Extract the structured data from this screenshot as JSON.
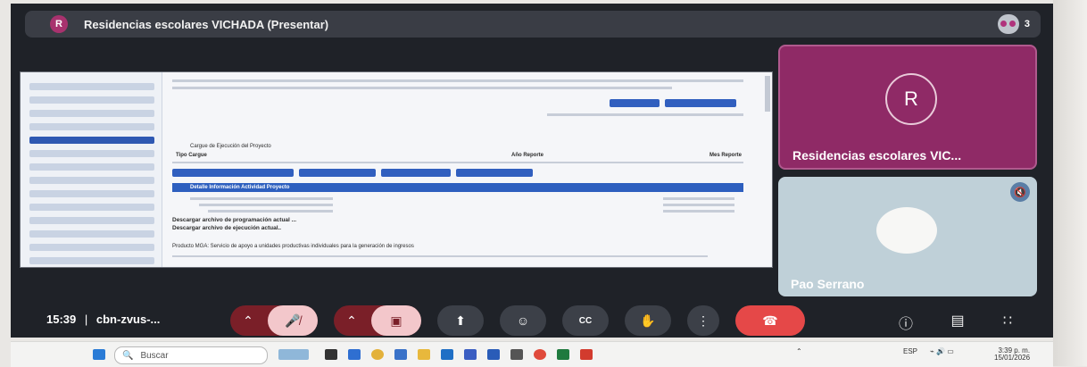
{
  "meeting": {
    "avatar_letter": "R",
    "title": "Residencias escolares VICHADA (Presentar)",
    "participant_count": "3"
  },
  "presentation": {
    "heading": "Cargue de Ejecución del Proyecto",
    "col_tipo": "Tipo Cargue",
    "col_anio": "Año Reporte",
    "col_mes": "Mes Reporte",
    "section": "Detalle Información Actividad Proyecto",
    "link1": "Descargar archivo de programación actual ...",
    "link2": "Descargar archivo de ejecución actual..",
    "producto": "Producto MGA: Servicio de apoyo a unidades productivas individuales para la generación de ingresos"
  },
  "tiles": [
    {
      "initial": "R",
      "name": "Residencias escolares VIC...",
      "bg": "#8f2a66"
    },
    {
      "name": "Pao Serrano",
      "bg": "#bfd0d8"
    }
  ],
  "controls": {
    "time": "15:39",
    "code": "cbn-zvus-..."
  },
  "taskbar": {
    "search_placeholder": "Buscar",
    "lang": "ESP",
    "time": "3:39 p. m.",
    "date": "15/01/2026"
  },
  "colors": {
    "frame": "#1f2228",
    "accent_red": "#e54848",
    "tile_magenta": "#8f2a66",
    "slide_blue": "#2d5fbf"
  }
}
